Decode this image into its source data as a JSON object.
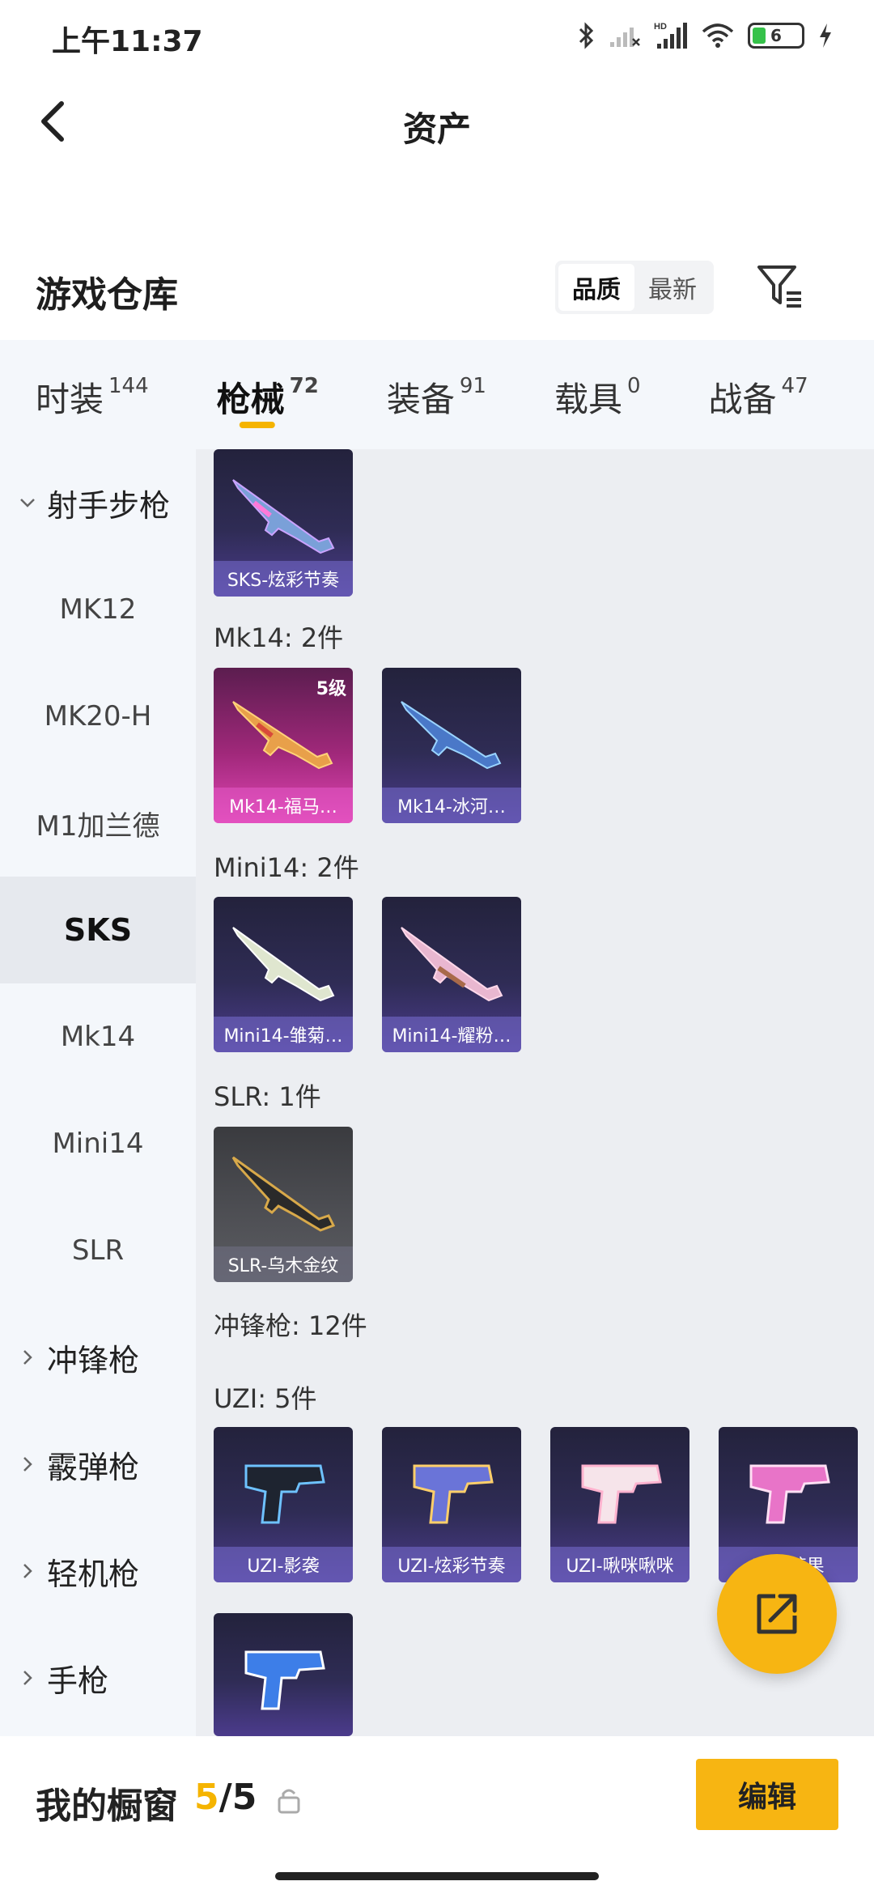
{
  "status_bar": {
    "time": "上午11:37",
    "battery": "6",
    "icons": [
      "bluetooth-icon",
      "signal-off-icon",
      "hd-signal-icon",
      "wifi-icon",
      "battery-icon",
      "charging-icon"
    ]
  },
  "header": {
    "title": "资产",
    "back_icon": "chevron-left-icon"
  },
  "warehouse": {
    "title": "游戏仓库",
    "sort_options": [
      "品质",
      "最新"
    ],
    "active_sort": "品质",
    "filter_icon": "filter-icon"
  },
  "category_tabs": [
    {
      "label": "时装",
      "count": "144"
    },
    {
      "label": "枪械",
      "count": "72"
    },
    {
      "label": "装备",
      "count": "91"
    },
    {
      "label": "载具",
      "count": "0"
    },
    {
      "label": "战备",
      "count": "47"
    }
  ],
  "active_tab": "枪械",
  "accent_color": "#f5b400",
  "sidebar": {
    "items": [
      {
        "label": "射手步枪",
        "type": "group",
        "expanded": true
      },
      {
        "label": "MK12",
        "type": "sub"
      },
      {
        "label": "MK20-H",
        "type": "sub"
      },
      {
        "label": "M1加兰德",
        "type": "sub"
      },
      {
        "label": "SKS",
        "type": "sub",
        "active": true
      },
      {
        "label": "Mk14",
        "type": "sub"
      },
      {
        "label": "Mini14",
        "type": "sub"
      },
      {
        "label": "SLR",
        "type": "sub"
      },
      {
        "label": "冲锋枪",
        "type": "group"
      },
      {
        "label": "霰弹枪",
        "type": "group"
      },
      {
        "label": "轻机枪",
        "type": "group"
      },
      {
        "label": "手枪",
        "type": "group"
      }
    ]
  },
  "content": {
    "sections": [
      {
        "label": "Mk14: 2件"
      },
      {
        "label": "Mini14: 2件"
      },
      {
        "label": "SLR: 1件"
      },
      {
        "label": "冲锋枪: 12件"
      },
      {
        "label": "UZI: 5件"
      }
    ],
    "cards": [
      {
        "name": "SKS-炫彩节奏",
        "style": "purple"
      },
      {
        "name": "Mk14-福马…",
        "style": "pink",
        "level": "5级"
      },
      {
        "name": "Mk14-冰河…",
        "style": "purple"
      },
      {
        "name": "Mini14-雏菊…",
        "style": "purple"
      },
      {
        "name": "Mini14-耀粉…",
        "style": "purple"
      },
      {
        "name": "SLR-乌木金纹",
        "style": "gray"
      },
      {
        "name": "UZI-影袭",
        "style": "purple"
      },
      {
        "name": "UZI-炫彩节奏",
        "style": "purple"
      },
      {
        "name": "UZI-啾咪啾咪",
        "style": "purple"
      },
      {
        "name": "UZI-糖果",
        "style": "purple"
      },
      {
        "name": "",
        "style": "purple"
      }
    ]
  },
  "fab": {
    "icon": "share-external-icon"
  },
  "bottom_bar": {
    "label": "我的橱窗",
    "count_current": "5",
    "count_total": "/5",
    "lock_icon": "lock-icon",
    "edit_label": "编辑"
  }
}
